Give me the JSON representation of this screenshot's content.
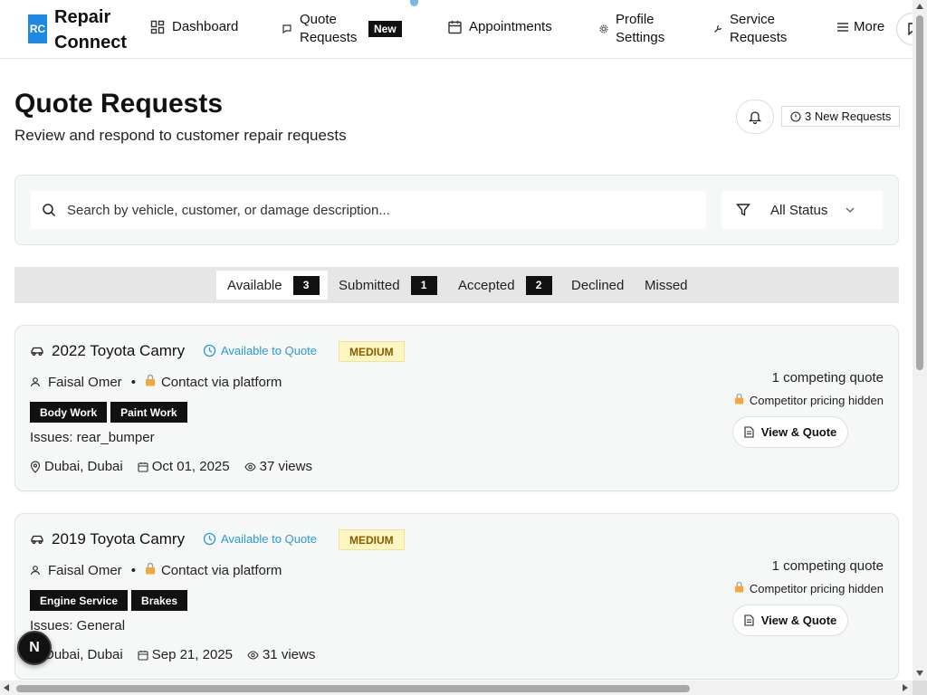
{
  "nav": {
    "logo_initials": "RC",
    "logo_text": "Repair Connect",
    "items": [
      {
        "label": "Dashboard",
        "icon": "dashboard-icon"
      },
      {
        "label": "Quote Requests",
        "icon": "message-icon",
        "badge": "New"
      },
      {
        "label": "Appointments",
        "icon": "calendar-icon"
      },
      {
        "label": "Profile Settings",
        "icon": "gear-icon"
      },
      {
        "label": "Service Requests",
        "icon": "wrench-icon"
      },
      {
        "label": "More",
        "icon": "menu-icon"
      }
    ]
  },
  "header": {
    "title": "Quote Requests",
    "subtitle": "Review and respond to customer repair requests",
    "new_requests": "3 New Requests"
  },
  "filters": {
    "search_placeholder": "Search by vehicle, customer, or damage description...",
    "status_value": "All Status"
  },
  "tabs": [
    {
      "label": "Available",
      "count": "3",
      "active": true
    },
    {
      "label": "Submitted",
      "count": "1"
    },
    {
      "label": "Accepted",
      "count": "2"
    },
    {
      "label": "Declined"
    },
    {
      "label": "Missed"
    }
  ],
  "cards": [
    {
      "vehicle": "2022 Toyota Camry",
      "status": "Available to Quote",
      "priority": "MEDIUM",
      "customer": "Faisal Omer",
      "contact": "Contact via platform",
      "tags": [
        "Body Work",
        "Paint Work"
      ],
      "issues": "Issues: rear_bumper",
      "location": "Dubai, Dubai",
      "date": "Oct 01, 2025",
      "views": "37 views",
      "competing": "1 competing quote",
      "pricing_note": "Competitor pricing hidden",
      "action": "View & Quote"
    },
    {
      "vehicle": "2019 Toyota Camry",
      "status": "Available to Quote",
      "priority": "MEDIUM",
      "customer": "Faisal Omer",
      "contact": "Contact via platform",
      "tags": [
        "Engine Service",
        "Brakes"
      ],
      "issues": "Issues: General",
      "location": "Dubai, Dubai",
      "date": "Sep 21, 2025",
      "views": "31 views",
      "competing": "1 competing quote",
      "pricing_note": "Competitor pricing hidden",
      "action": "View & Quote"
    }
  ],
  "fab_label": "N",
  "colors": {
    "brand": "#1e88e5",
    "status_blue": "#2a9ad6",
    "priority_bg": "#fdf6c3",
    "priority_text": "#8a5a00",
    "badge_dark": "#111111"
  }
}
